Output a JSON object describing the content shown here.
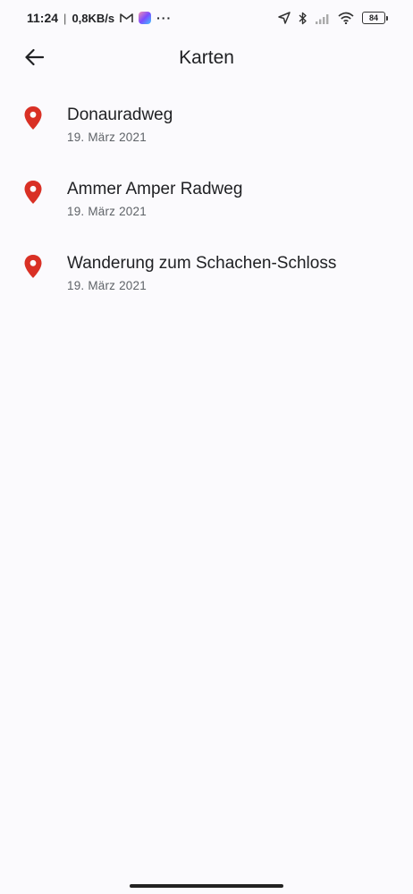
{
  "status_bar": {
    "time": "11:24",
    "separator": "|",
    "net_speed": "0,8KB/s",
    "more_dots": "···",
    "battery_level": "84",
    "icons": [
      "gmail-icon",
      "app-badge-icon",
      "location-arrow-icon",
      "bluetooth-icon",
      "signal-icon",
      "wifi-icon",
      "battery-icon"
    ]
  },
  "app_bar": {
    "title": "Karten",
    "back_icon": "arrow-back-icon"
  },
  "maps": [
    {
      "title": "Donauradweg",
      "date": "19. März 2021",
      "icon": "map-pin-icon"
    },
    {
      "title": "Ammer Amper Radweg",
      "date": "19. März 2021",
      "icon": "map-pin-icon"
    },
    {
      "title": "Wanderung zum Schachen-Schloss",
      "date": "19. März 2021",
      "icon": "map-pin-icon"
    }
  ],
  "colors": {
    "background": "#fbfafd",
    "pin": "#d93025",
    "text_primary": "#202124",
    "text_secondary": "#5f6368"
  }
}
